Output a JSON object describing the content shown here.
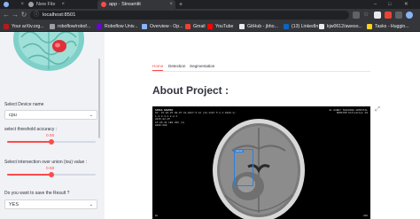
{
  "browser": {
    "tabs": [
      {
        "title": "",
        "icon_color": "#8ab4f8",
        "active": false
      },
      {
        "title": "New File",
        "icon_color": "#9aa0a6",
        "active": false
      },
      {
        "title": "app · Streamlit",
        "icon_color": "#ff4b4b",
        "active": true
      }
    ],
    "new_tab_symbol": "+",
    "window_controls": {
      "minimize": "–",
      "maximize": "□",
      "close": "✕"
    },
    "address": {
      "url": "localhost:8501"
    },
    "bookmarks": [
      {
        "label": "Your arXiv.org...",
        "color": "#b31b1b"
      },
      {
        "label": "roboflow/robof...",
        "color": "#9aa0a6"
      },
      {
        "label": "Roboflow Univ...",
        "color": "#6706ce"
      },
      {
        "label": "Overview - Op...",
        "color": "#8ab4f8"
      },
      {
        "label": "Gmail",
        "color": "#ea4335"
      },
      {
        "label": "YouTube",
        "color": "#ff0000"
      },
      {
        "label": "GitHub - jbho...",
        "color": "#e8eaed"
      },
      {
        "label": "(13) LinkedIn",
        "color": "#0a66c2"
      },
      {
        "label": "kjw0612/aweso...",
        "color": "#e8eaed"
      },
      {
        "label": "Tasks - Huggin...",
        "color": "#ffd21e"
      }
    ]
  },
  "sidebar": {
    "device_label": "Select Device name",
    "device_value": "cpu",
    "threshold_label": "select threshold accuracy :",
    "threshold_value": "0.50",
    "threshold_fraction": 0.5,
    "iou_label": "Select intersection over union (iou) value :",
    "iou_value": "0.50",
    "iou_fraction": 0.5,
    "save_label": "Do you want to save the Result ?",
    "save_value": "YES"
  },
  "main": {
    "nav_tabs": [
      {
        "label": "Home",
        "active": true
      },
      {
        "label": "Detection",
        "active": false
      },
      {
        "label": "Segmentation",
        "active": false
      }
    ],
    "page_title": "About Project :",
    "scan": {
      "left_header": [
        "SAMAA DAGMID",
        "ID: 15-02-25 09:07 44-0327.5.12 (12.1107.5.1.4.0320.1)",
        "1.2.3.4.1.2.2.1",
        "2015.02.25",
        "15-06-41 LB8 200 (1)",
        "0800.000"
      ],
      "right_header": [
        "AL HIBEY TEACHING HOSPITAL",
        "SOMATOM Definition AS"
      ],
      "detection_label": "tumor",
      "detection_color": "#2b7fe0",
      "footer_left": "WL",
      "footer_right": "200"
    },
    "expand_icon": "expand-icon"
  }
}
